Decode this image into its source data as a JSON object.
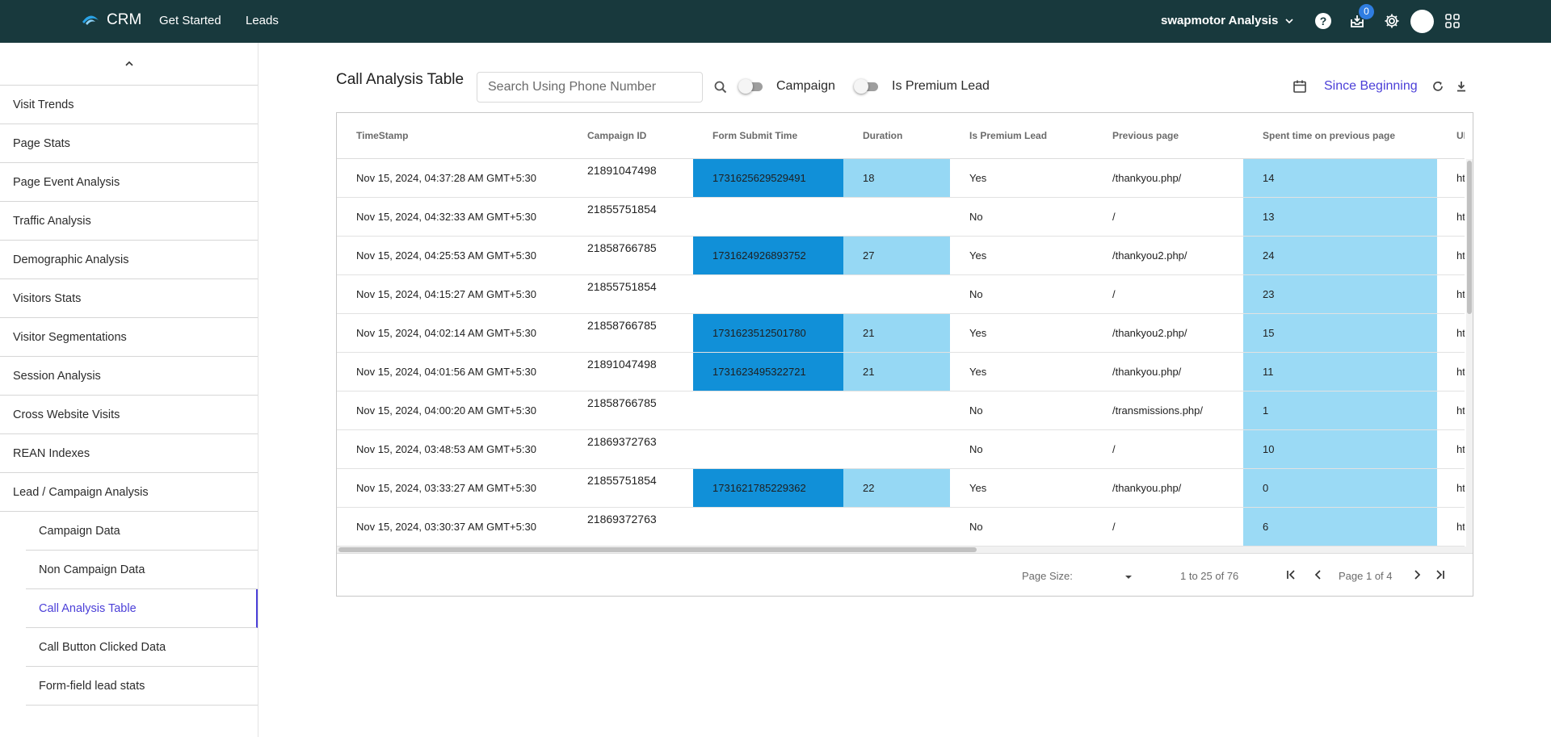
{
  "app": {
    "brand": "CRM",
    "nav": [
      "Get Started",
      "Leads"
    ],
    "account": "swapmotor Analysis",
    "inbox_count": "0"
  },
  "sidebar": {
    "items": [
      "Visit Trends",
      "Page Stats",
      "Page Event Analysis",
      "Traffic Analysis",
      "Demographic Analysis",
      "Visitors Stats",
      "Visitor Segmentations",
      "Session Analysis",
      "Cross Website Visits",
      "REAN Indexes",
      "Lead / Campaign Analysis"
    ],
    "sub_items": [
      "Campaign Data",
      "Non Campaign Data",
      "Call Analysis Table",
      "Call Button Clicked Data",
      "Form-field lead stats"
    ],
    "active": "Call Analysis Table"
  },
  "main": {
    "title": "Call Analysis Table",
    "search_placeholder": "Search Using Phone Number",
    "toggle_campaign": "Campaign",
    "toggle_premium": "Is Premium Lead",
    "date_range": "Since Beginning"
  },
  "colors": {
    "topbar": "#18393d",
    "accent": "#4b3fd8",
    "cell_dark": "#1190d8",
    "cell_light": "#96d8f4"
  },
  "table": {
    "columns": [
      "TimeStamp",
      "Campaign ID",
      "Form Submit Time",
      "Duration",
      "Is Premium Lead",
      "Previous page",
      "Spent time on previous page",
      "URL"
    ],
    "rows": [
      [
        "Nov 15, 2024, 04:37:28 AM GMT+5:30",
        "21891047498",
        "1731625629529491",
        "18",
        "Yes",
        "/thankyou.php/",
        "14",
        "ht"
      ],
      [
        "Nov 15, 2024, 04:32:33 AM GMT+5:30",
        "21855751854",
        "",
        "",
        "No",
        "/",
        "13",
        "ht"
      ],
      [
        "Nov 15, 2024, 04:25:53 AM GMT+5:30",
        "21858766785",
        "1731624926893752",
        "27",
        "Yes",
        "/thankyou2.php/",
        "24",
        "ht"
      ],
      [
        "Nov 15, 2024, 04:15:27 AM GMT+5:30",
        "21855751854",
        "",
        "",
        "No",
        "/",
        "23",
        "ht"
      ],
      [
        "Nov 15, 2024, 04:02:14 AM GMT+5:30",
        "21858766785",
        "1731623512501780",
        "21",
        "Yes",
        "/thankyou2.php/",
        "15",
        "ht"
      ],
      [
        "Nov 15, 2024, 04:01:56 AM GMT+5:30",
        "21891047498",
        "1731623495322721",
        "21",
        "Yes",
        "/thankyou.php/",
        "11",
        "ht"
      ],
      [
        "Nov 15, 2024, 04:00:20 AM GMT+5:30",
        "21858766785",
        "",
        "",
        "No",
        "/transmissions.php/",
        "1",
        "ht"
      ],
      [
        "Nov 15, 2024, 03:48:53 AM GMT+5:30",
        "21869372763",
        "",
        "",
        "No",
        "/",
        "10",
        "ht"
      ],
      [
        "Nov 15, 2024, 03:33:27 AM GMT+5:30",
        "21855751854",
        "1731621785229362",
        "22",
        "Yes",
        "/thankyou.php/",
        "0",
        "ht"
      ],
      [
        "Nov 15, 2024, 03:30:37 AM GMT+5:30",
        "21869372763",
        "",
        "",
        "No",
        "/",
        "6",
        "ht"
      ]
    ]
  },
  "pagination": {
    "page_size_label": "Page Size:",
    "range": "1 to 25 of 76",
    "page": "Page 1 of 4"
  }
}
